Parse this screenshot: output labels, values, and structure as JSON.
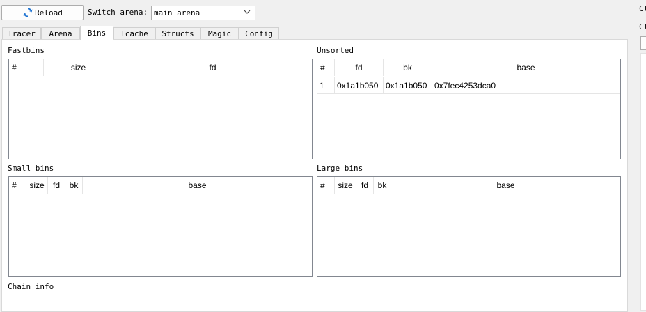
{
  "toolbar": {
    "reload_label": "Reload",
    "switch_arena_label": "Switch arena:",
    "arena_value": "main_arena"
  },
  "tabs": [
    {
      "label": "Tracer"
    },
    {
      "label": "Arena"
    },
    {
      "label": "Bins",
      "active": true
    },
    {
      "label": "Tcache"
    },
    {
      "label": "Structs"
    },
    {
      "label": "Magic"
    },
    {
      "label": "Config"
    }
  ],
  "fastbins": {
    "title": "Fastbins",
    "columns": [
      "#",
      "size",
      "fd"
    ]
  },
  "unsorted": {
    "title": "Unsorted",
    "columns": [
      "#",
      "fd",
      "bk",
      "base"
    ],
    "rows": [
      {
        "num": "1",
        "fd": "0x1a1b050",
        "bk": "0x1a1b050",
        "base": "0x7fec4253dca0"
      }
    ]
  },
  "small_bins": {
    "title": "Small bins",
    "columns": [
      "#",
      "size",
      "fd",
      "bk",
      "base"
    ]
  },
  "large_bins": {
    "title": "Large bins",
    "columns": [
      "#",
      "size",
      "fd",
      "bk",
      "base"
    ]
  },
  "chain_info": {
    "title": "Chain info"
  },
  "right_panel": {
    "label_top": "Cl",
    "label_second": "Cl"
  },
  "colors": {
    "reload_icon": "#1e73d2",
    "window_bg": "#f0f0f0",
    "table_border": "#828790"
  }
}
